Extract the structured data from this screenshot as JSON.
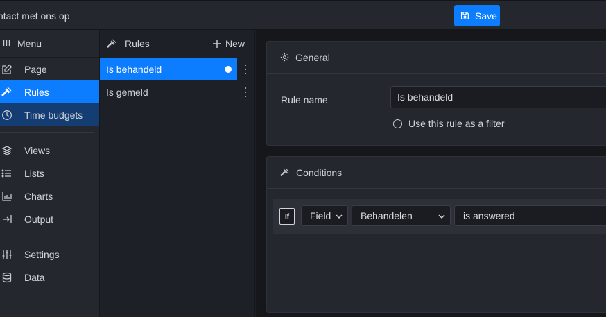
{
  "topbar": {
    "title": "ntact met ons op",
    "save_label": "Save"
  },
  "menu": {
    "header": "Menu",
    "items": [
      {
        "label": "Page",
        "icon": "edit-icon"
      },
      {
        "label": "Rules",
        "icon": "gavel-icon"
      },
      {
        "label": "Time budgets",
        "icon": "clock-icon"
      },
      {
        "label": "Views",
        "icon": "layers-icon"
      },
      {
        "label": "Lists",
        "icon": "list-icon"
      },
      {
        "label": "Charts",
        "icon": "bar-chart-icon"
      },
      {
        "label": "Output",
        "icon": "output-icon"
      },
      {
        "label": "Settings",
        "icon": "sliders-icon"
      },
      {
        "label": "Data",
        "icon": "database-icon"
      }
    ]
  },
  "rules": {
    "header": "Rules",
    "new_label": "New",
    "items": [
      {
        "label": "Is behandeld"
      },
      {
        "label": "Is gemeld"
      }
    ]
  },
  "general": {
    "title": "General",
    "rule_name_label": "Rule name",
    "rule_name_value": "Is behandeld",
    "filter_label": "Use this rule as a filter"
  },
  "conditions": {
    "title": "Conditions",
    "if_label": "If",
    "field_type": "Field",
    "field": "Behandelen",
    "operator": "is answered"
  },
  "colors": {
    "accent": "#0d7dff",
    "background": "#1d2026",
    "panel": "#24272e"
  }
}
